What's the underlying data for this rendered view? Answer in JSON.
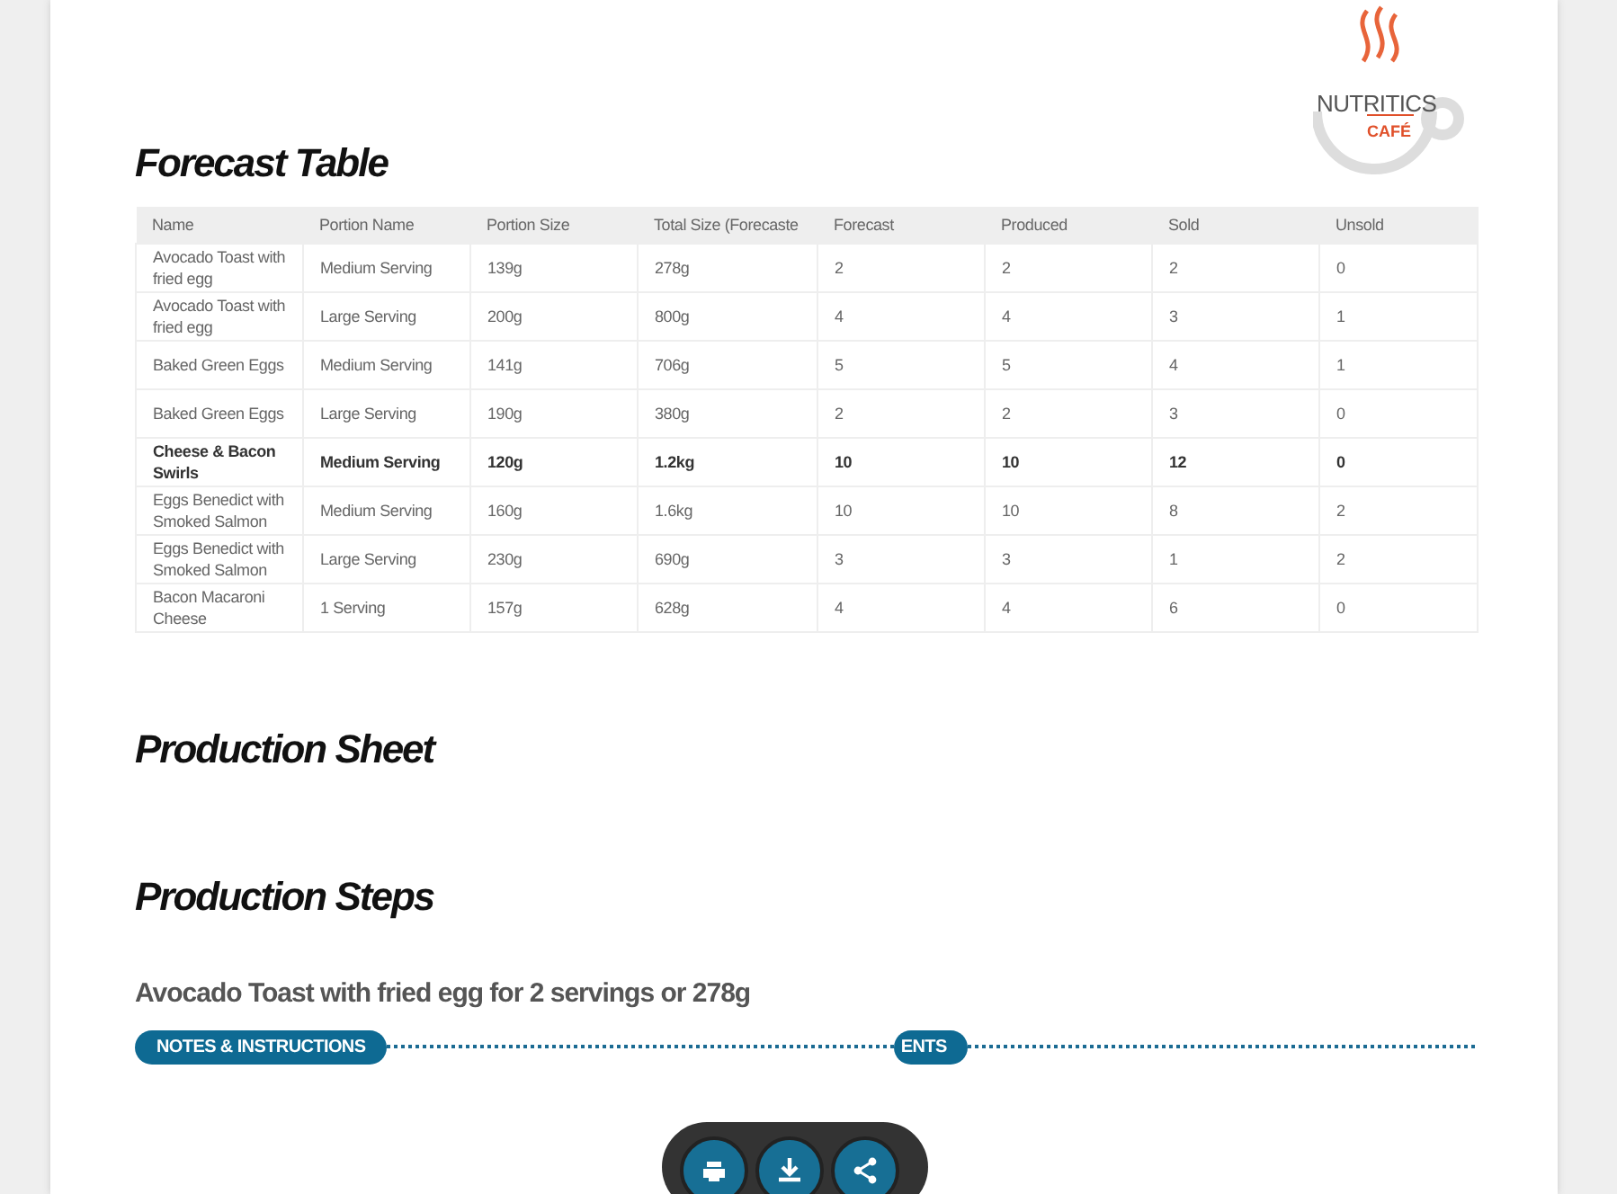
{
  "logo": {
    "brand": "NUTRITICS",
    "sub": "CAFÉ"
  },
  "forecast_table": {
    "title": "Forecast Table",
    "columns": [
      "Name",
      "Portion Name",
      "Portion Size",
      "Total Size (Forecaste",
      "Forecast",
      "Produced",
      "Sold",
      "Unsold"
    ],
    "rows": [
      {
        "highlighted": false,
        "cells": [
          "Avocado Toast with fried egg",
          "Medium Serving",
          "139g",
          "278g",
          "2",
          "2",
          "2",
          "0"
        ]
      },
      {
        "highlighted": false,
        "cells": [
          "Avocado Toast with fried egg",
          "Large Serving",
          "200g",
          "800g",
          "4",
          "4",
          "3",
          "1"
        ]
      },
      {
        "highlighted": false,
        "cells": [
          "Baked Green Eggs",
          "Medium Serving",
          "141g",
          "706g",
          "5",
          "5",
          "4",
          "1"
        ]
      },
      {
        "highlighted": false,
        "cells": [
          "Baked Green Eggs",
          "Large Serving",
          "190g",
          "380g",
          "2",
          "2",
          "3",
          "0"
        ]
      },
      {
        "highlighted": true,
        "cells": [
          "Cheese & Bacon Swirls",
          "Medium Serving",
          "120g",
          "1.2kg",
          "10",
          "10",
          "12",
          "0"
        ]
      },
      {
        "highlighted": false,
        "cells": [
          "Eggs Benedict with Smoked Salmon",
          "Medium Serving",
          "160g",
          "1.6kg",
          "10",
          "10",
          "8",
          "2"
        ]
      },
      {
        "highlighted": false,
        "cells": [
          "Eggs Benedict with Smoked Salmon",
          "Large Serving",
          "230g",
          "690g",
          "3",
          "3",
          "1",
          "2"
        ]
      },
      {
        "highlighted": false,
        "cells": [
          "Bacon Macaroni Cheese",
          "1 Serving",
          "157g",
          "628g",
          "4",
          "4",
          "6",
          "0"
        ]
      }
    ]
  },
  "production_sheet": {
    "title": "Production Sheet"
  },
  "production_steps": {
    "title": "Production Steps",
    "recipe_heading": "Avocado Toast with fried egg for 2 servings or 278g",
    "tabs": [
      {
        "label": "NOTES & INSTRUCTIONS"
      },
      {
        "label": "ENTS"
      }
    ]
  },
  "toolbar": {
    "buttons": [
      {
        "kind": "print"
      },
      {
        "kind": "download"
      },
      {
        "kind": "share"
      }
    ]
  }
}
